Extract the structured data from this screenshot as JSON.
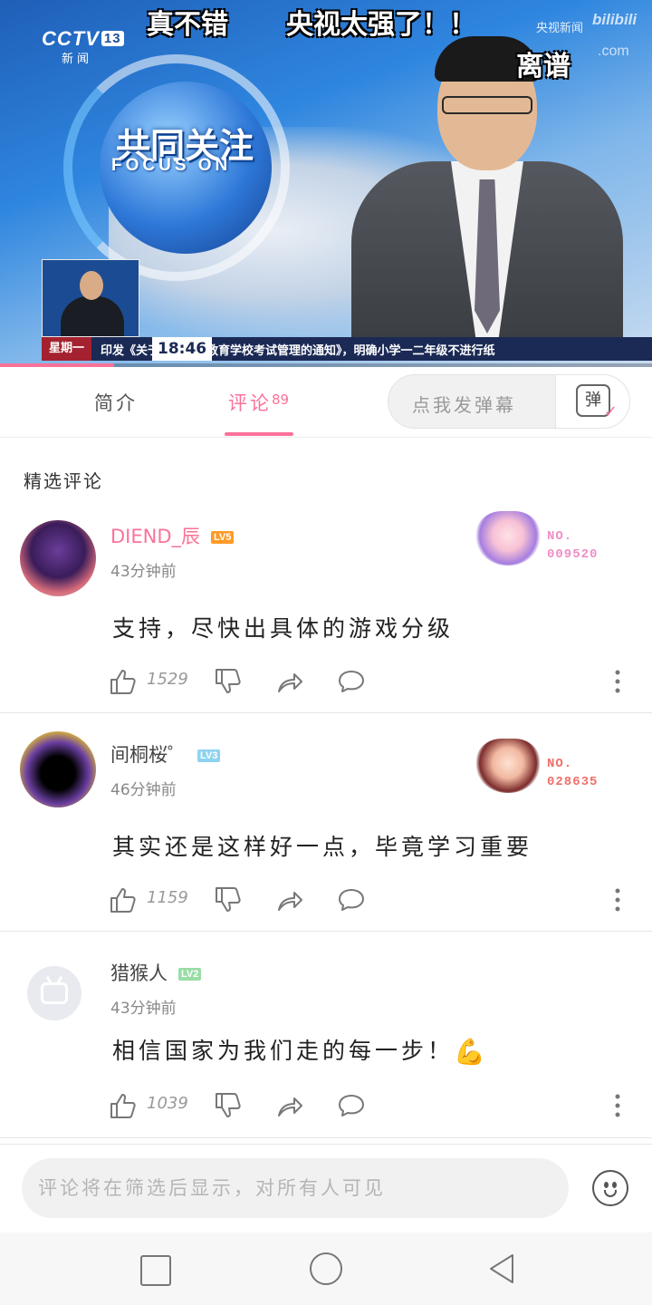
{
  "video": {
    "channel_logo": "CCTV",
    "channel_number": "13",
    "channel_sub": "新闻",
    "show_title_cn": "共同关注",
    "show_title_en": "FOCUS ON",
    "ticker_day": "星期一",
    "ticker_time": "18:46",
    "ticker_text": "印发《关于加强义务教育学校考试管理的通知》，明确小学一二年级不进行纸",
    "danmaku": [
      "真不错",
      "央视太强了！！",
      "离谱"
    ],
    "watermark_source": "央视新闻",
    "watermark_site": "bilibili",
    "watermark_domain": ".com",
    "progress_fraction": 0.175
  },
  "tabs": {
    "intro_label": "简介",
    "comments_label": "评论",
    "comments_count": "89",
    "danmaku_placeholder": "点我发弹幕",
    "danmaku_icon_char": "弹"
  },
  "section_title": "精选评论",
  "comments": [
    {
      "username": "DIEND_辰",
      "level": "LV5",
      "time": "43分钟前",
      "text": "支持，尽快出具体的游戏分级",
      "likes": "1529",
      "fan_no_label": "NO.",
      "fan_no": "009520"
    },
    {
      "username": "间桐桜゜",
      "level": "LV3",
      "time": "46分钟前",
      "text": "其实还是这样好一点，毕竟学习重要",
      "likes": "1159",
      "fan_no_label": "NO.",
      "fan_no": "028635"
    },
    {
      "username": "猎猴人",
      "level": "LV2",
      "time": "43分钟前",
      "text": "相信国家为我们走的每一步！",
      "emoji": "💪",
      "likes": "1039"
    }
  ],
  "input": {
    "placeholder": "评论将在筛选后显示，对所有人可见"
  },
  "colors": {
    "accent": "#fb7299",
    "lv5": "#ff9a25",
    "lv3": "#8ed3f0",
    "lv2": "#98dda5"
  },
  "icons": [
    "thumbs-up-icon",
    "thumbs-down-icon",
    "share-icon",
    "reply-icon",
    "more-icon",
    "emoji-icon",
    "danmaku-icon"
  ]
}
